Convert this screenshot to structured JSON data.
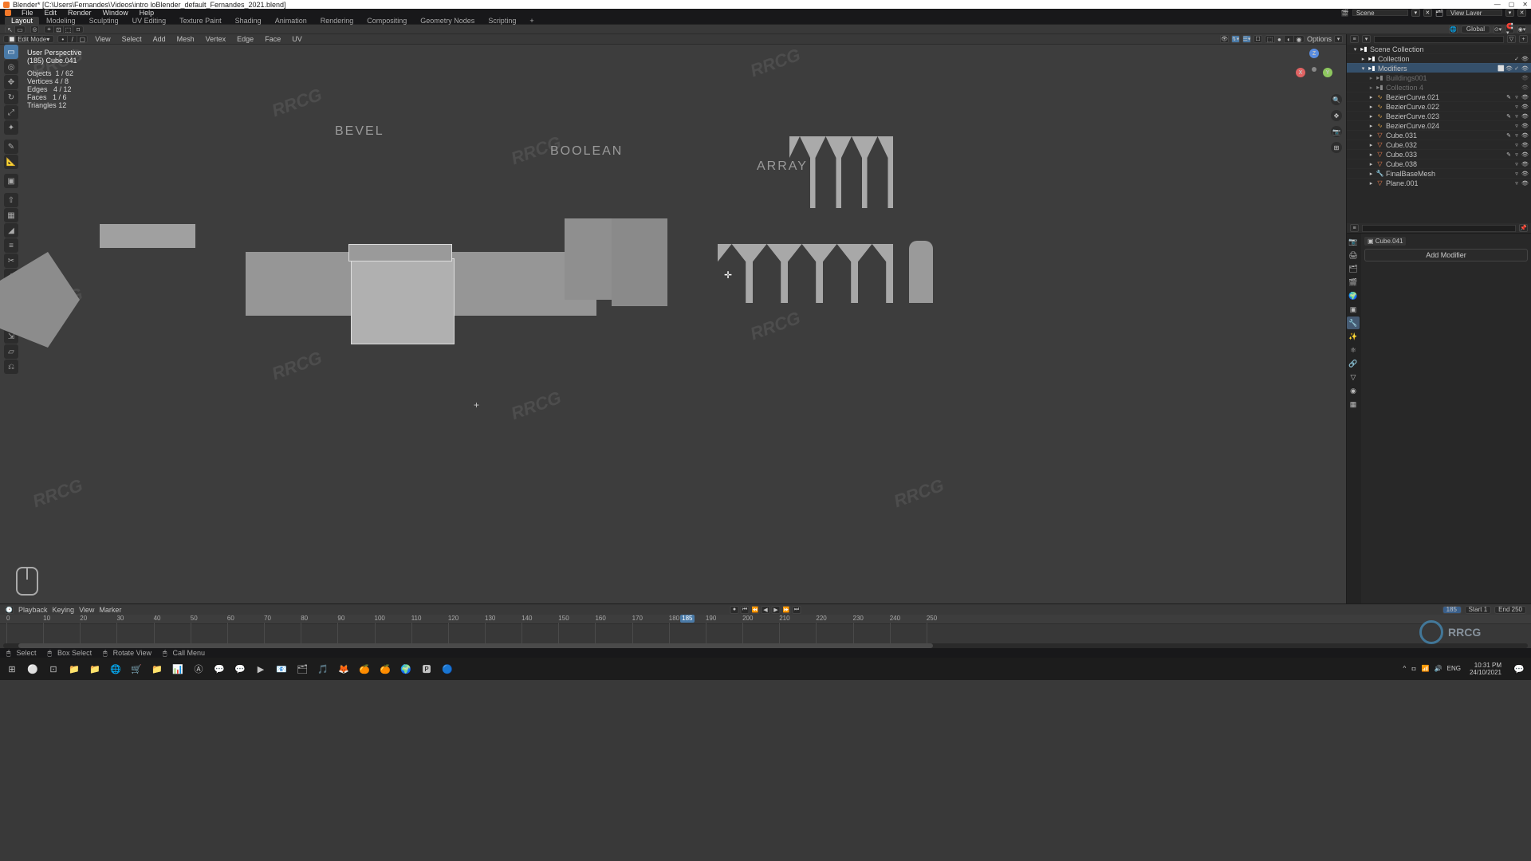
{
  "window": {
    "title": "Blender* [C:\\Users\\Fernandes\\Videos\\intro loBlender_default_Fernandes_2021.blend]",
    "minimize": "—",
    "maximize": "▢",
    "close": "✕"
  },
  "scene_field": "Scene",
  "viewlayer_field": "View Layer",
  "menubar": [
    "File",
    "Edit",
    "Render",
    "Window",
    "Help"
  ],
  "workspaces": [
    "Layout",
    "Modeling",
    "Sculpting",
    "UV Editing",
    "Texture Paint",
    "Shading",
    "Animation",
    "Rendering",
    "Compositing",
    "Geometry Nodes",
    "Scripting",
    "+"
  ],
  "active_workspace": "Layout",
  "pivot_dropdown": "Global",
  "viewport": {
    "mode": "Edit Mode",
    "menus": [
      "View",
      "Select",
      "Add",
      "Mesh",
      "Vertex",
      "Edge",
      "Face",
      "UV"
    ],
    "options_label": "Options",
    "overlay": {
      "line1": "User Perspective",
      "line2": "(185) Cube.041",
      "stats": [
        {
          "label": "Objects",
          "value": "1 / 62"
        },
        {
          "label": "Vertices",
          "value": "4 / 8"
        },
        {
          "label": "Edges",
          "value": "4 / 12"
        },
        {
          "label": "Faces",
          "value": "1 / 6"
        },
        {
          "label": "Triangles",
          "value": "12"
        }
      ]
    },
    "labels3d": {
      "bevel": "BEVEL",
      "boolean": "BOOLEAN",
      "array": "ARRAY"
    },
    "gizmo": {
      "x": "X",
      "y": "Y",
      "z": "Z"
    }
  },
  "tools": [
    "Select",
    "Cursor",
    "Move",
    "Rotate",
    "Scale",
    "Transform",
    "Annotate",
    "Measure",
    "AddCube",
    "Extrude",
    "ExtrudeManifold",
    "Inset",
    "Bevel",
    "LoopCut",
    "Knife",
    "Bisect",
    "PolyBuild",
    "Spin",
    "SpinDup",
    "Smooth",
    "EdgeSlide",
    "Shrink",
    "Shear",
    "Rip"
  ],
  "outliner": {
    "search_placeholder": "",
    "rows": [
      {
        "depth": 0,
        "expander": "▾",
        "icon": "coll",
        "name": "Scene Collection",
        "badges": [],
        "sel": false
      },
      {
        "depth": 1,
        "expander": "▸",
        "icon": "coll",
        "name": "Collection",
        "badges": [
          "✓",
          "👁"
        ],
        "sel": false
      },
      {
        "depth": 1,
        "expander": "▾",
        "icon": "coll",
        "name": "Modifiers",
        "badges": [
          "⬜",
          "👁",
          "✓",
          "👁"
        ],
        "sel": false,
        "highlight": true
      },
      {
        "depth": 2,
        "expander": "▸",
        "icon": "coll",
        "name": "Buildings001",
        "badges": [
          "👁"
        ],
        "dim": true
      },
      {
        "depth": 2,
        "expander": "▸",
        "icon": "coll",
        "name": "Collection 4",
        "badges": [
          "👁"
        ],
        "dim": true
      },
      {
        "depth": 2,
        "expander": "▸",
        "icon": "curve",
        "name": "BezierCurve.021",
        "badges": [
          "✎",
          "▿",
          "👁"
        ]
      },
      {
        "depth": 2,
        "expander": "▸",
        "icon": "curve",
        "name": "BezierCurve.022",
        "badges": [
          "▿",
          "👁"
        ]
      },
      {
        "depth": 2,
        "expander": "▸",
        "icon": "curve",
        "name": "BezierCurve.023",
        "badges": [
          "✎",
          "▿",
          "👁"
        ]
      },
      {
        "depth": 2,
        "expander": "▸",
        "icon": "curve",
        "name": "BezierCurve.024",
        "badges": [
          "▿",
          "👁"
        ]
      },
      {
        "depth": 2,
        "expander": "▸",
        "icon": "mesh",
        "name": "Cube.031",
        "badges": [
          "✎",
          "▿",
          "👁"
        ]
      },
      {
        "depth": 2,
        "expander": "▸",
        "icon": "mesh",
        "name": "Cube.032",
        "badges": [
          "▿",
          "👁"
        ]
      },
      {
        "depth": 2,
        "expander": "▸",
        "icon": "mesh",
        "name": "Cube.033",
        "badges": [
          "✎",
          "▿",
          "👁"
        ]
      },
      {
        "depth": 2,
        "expander": "▸",
        "icon": "mesh",
        "name": "Cube.038",
        "badges": [
          "▿",
          "👁"
        ]
      },
      {
        "depth": 2,
        "expander": "▸",
        "icon": "mod",
        "name": "FinalBaseMesh",
        "badges": [
          "▿",
          "👁"
        ]
      },
      {
        "depth": 2,
        "expander": "▸",
        "icon": "plane",
        "name": "Plane.001",
        "badges": [
          "▿",
          "👁"
        ]
      }
    ]
  },
  "properties": {
    "crumb": "Cube.041",
    "add_modifier": "Add Modifier",
    "tabs": [
      "render",
      "output",
      "viewlayer",
      "scene",
      "world",
      "object",
      "modifier",
      "particles",
      "physics",
      "constraint",
      "data",
      "material",
      "texture"
    ]
  },
  "timeline": {
    "menus": [
      "Playback",
      "Keying",
      "View",
      "Marker"
    ],
    "play_icons": [
      "⏮",
      "⏪",
      "◀",
      "⏺",
      "▶",
      "⏩",
      "⏭"
    ],
    "current": "185",
    "start_label": "Start",
    "start": "1",
    "end_label": "End",
    "end": "250",
    "ticks": [
      0,
      10,
      20,
      30,
      40,
      50,
      60,
      70,
      80,
      90,
      100,
      110,
      120,
      130,
      140,
      150,
      160,
      170,
      180,
      190,
      200,
      210,
      220,
      230,
      240,
      250
    ],
    "cursor_frame": "185"
  },
  "statusbar": {
    "items": [
      {
        "icon": "🖱",
        "text": "Select"
      },
      {
        "icon": "🖱",
        "text": "Box Select"
      },
      {
        "icon": "🖱",
        "text": "Rotate View"
      },
      {
        "icon": "🖱",
        "text": "Call Menu"
      }
    ]
  },
  "taskbar": {
    "apps": [
      "⊞",
      "⚪",
      "⊡",
      "📁",
      "📁",
      "🌐",
      "🛒",
      "📁",
      "📊",
      "Ⓐ",
      "💬",
      "💬",
      "▶",
      "📧",
      "🗂",
      "🎵",
      "🦊",
      "🍊",
      "🍊",
      "🌍",
      "🅿",
      "🔵"
    ],
    "tray": [
      "^",
      "ㅁ",
      "📶",
      "🔊",
      "ENG"
    ],
    "clock_time": "10:31 PM",
    "clock_date": "24/10/2021"
  },
  "watermark_text": "RRCG"
}
